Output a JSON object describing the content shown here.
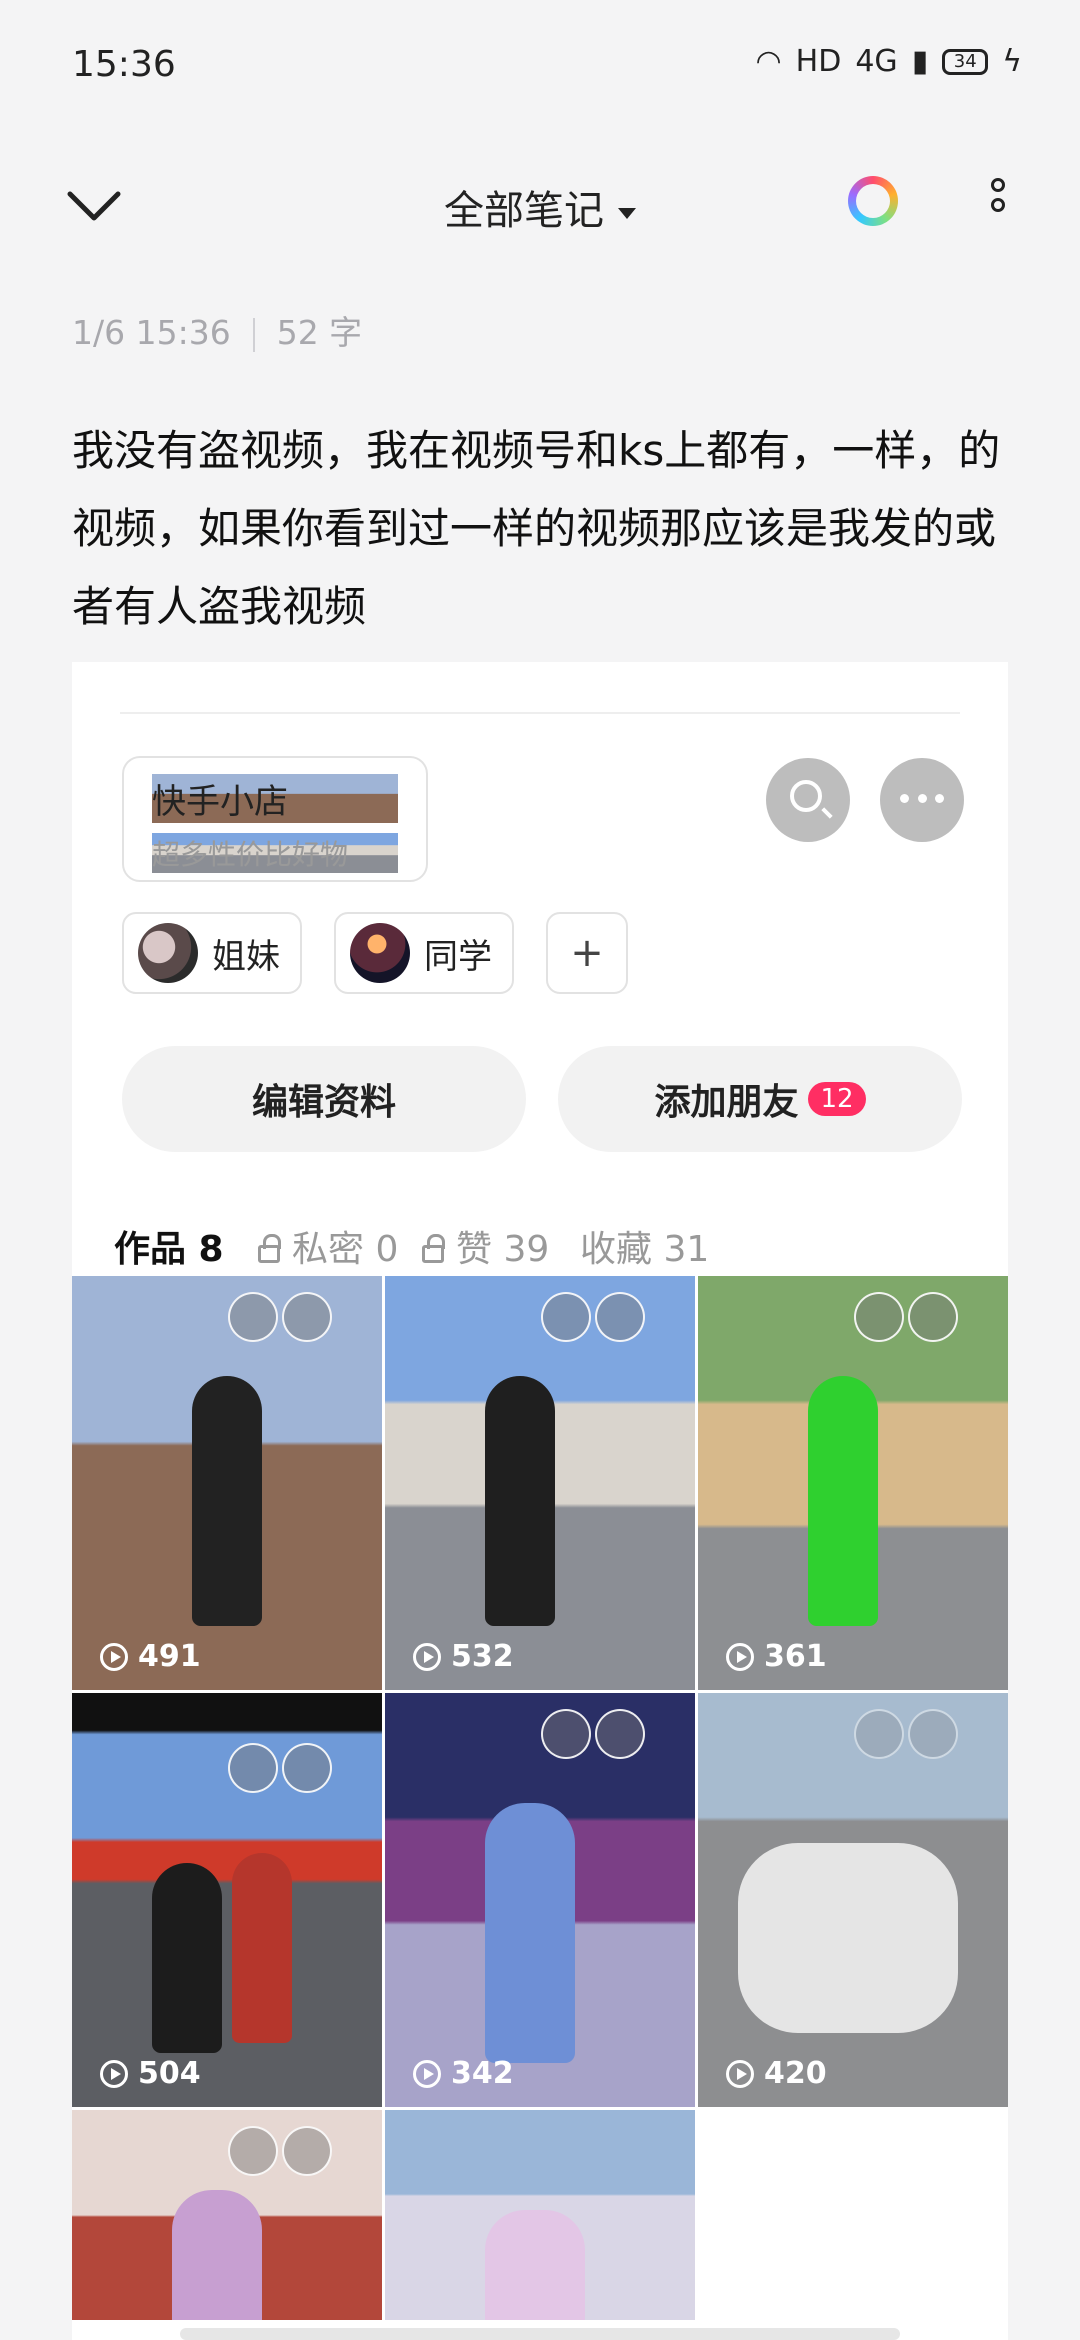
{
  "status_bar": {
    "time": "15:36",
    "hd": "HD",
    "network": "4G",
    "battery": "34"
  },
  "header": {
    "title": "全部笔记"
  },
  "note": {
    "date": "1/6 15:36",
    "word_count": "52 字",
    "text": "我没有盗视频，我在视频号和ks上都有，一样，的视频，如果你看到过一样的视频那应该是我发的或者有人盗我视频"
  },
  "profile": {
    "shop": {
      "title": "快手小店",
      "subtitle": "超多性价比好物"
    },
    "chips": [
      {
        "label": "姐妹"
      },
      {
        "label": "同学"
      }
    ],
    "plus": "+",
    "edit_button": "编辑资料",
    "add_friend_button": "添加朋友",
    "add_friend_badge": "12",
    "tabs": [
      {
        "label": "作品 8"
      },
      {
        "label": "私密 0"
      },
      {
        "label": "赞 39"
      },
      {
        "label": "收藏 31"
      }
    ],
    "videos": [
      {
        "views": "491"
      },
      {
        "views": "532"
      },
      {
        "views": "361"
      },
      {
        "views": "504"
      },
      {
        "views": "342"
      },
      {
        "views": "420"
      },
      {
        "views": ""
      },
      {
        "views": ""
      }
    ]
  }
}
